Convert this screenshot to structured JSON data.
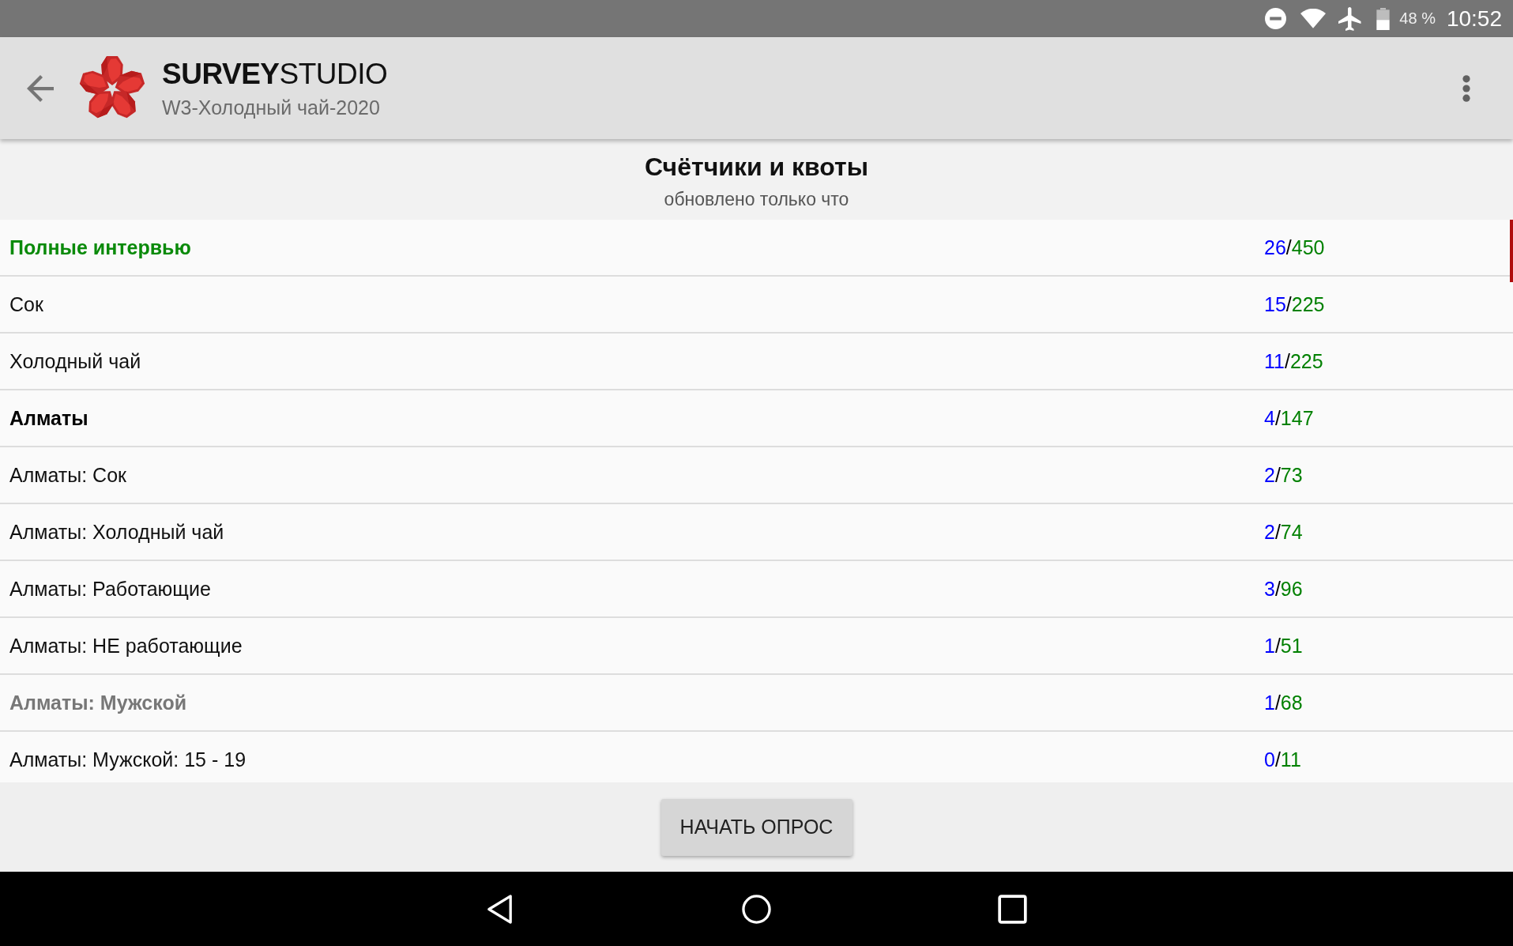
{
  "status_bar": {
    "battery_percent": "48 %",
    "time": "10:52"
  },
  "app_bar": {
    "title": "**SURVEY**STUDIO",
    "subtitle": "W3-Холодный чай-2020"
  },
  "header": {
    "title": "Счётчики и квоты",
    "subtitle": "обновлено только что"
  },
  "counters": [
    {
      "kind": "total",
      "label": "Полные интервью",
      "count": "26",
      "separator": "/",
      "quota": "450"
    },
    {
      "kind": "item",
      "label": "Сок",
      "count": "15",
      "separator": "/",
      "quota": "225"
    },
    {
      "kind": "item",
      "label": "Холодный чай",
      "count": "11",
      "separator": "/",
      "quota": "225"
    },
    {
      "kind": "group",
      "label": "Алматы",
      "count": "4",
      "separator": "/",
      "quota": "147"
    },
    {
      "kind": "item",
      "label": "Алматы: Сок",
      "count": "2",
      "separator": "/",
      "quota": "73"
    },
    {
      "kind": "item",
      "label": "Алматы: Холодный чай",
      "count": "2",
      "separator": "/",
      "quota": "74"
    },
    {
      "kind": "item",
      "label": "Алматы: Работающие",
      "count": "3",
      "separator": "/",
      "quota": "96"
    },
    {
      "kind": "item",
      "label": "Алматы: НЕ работающие",
      "count": "1",
      "separator": "/",
      "quota": "51"
    },
    {
      "kind": "muted",
      "label": "Алматы: Мужской",
      "count": "1",
      "separator": "/",
      "quota": "68"
    },
    {
      "kind": "item",
      "label": "Алматы: Мужской: 15 - 19",
      "count": "0",
      "separator": "/",
      "quota": "11"
    }
  ],
  "start_button": {
    "label": "НАЧАТЬ ОПРОС"
  }
}
